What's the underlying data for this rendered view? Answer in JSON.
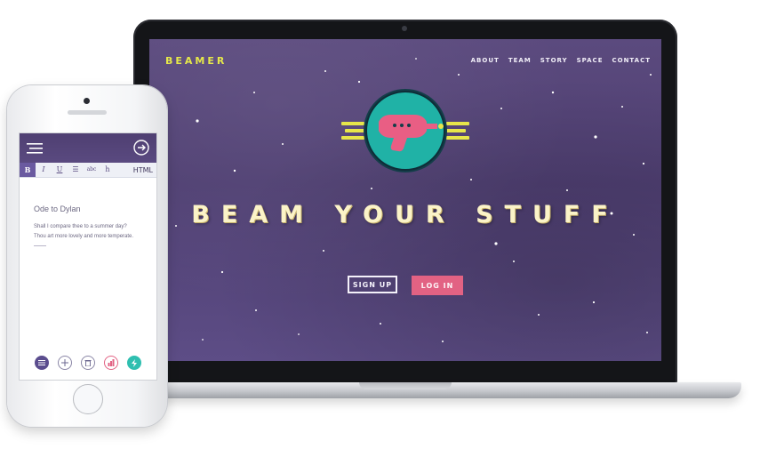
{
  "laptop": {
    "brand": "BEAMER",
    "nav": [
      "ABOUT",
      "TEAM",
      "STORY",
      "SPACE",
      "CONTACT"
    ],
    "hero_title": "BEAM YOUR STUFF",
    "signup_label": "SIGN UP",
    "login_label": "LOG IN",
    "colors": {
      "brand": "#e5e84a",
      "login_button": "#e26283",
      "badge_teal": "#1fb1a6",
      "background": "#54437a"
    },
    "logo_icon": "ray-gun-icon"
  },
  "phone": {
    "toolbar": {
      "bold": "B",
      "italic": "I",
      "underline": "U",
      "list": "☰",
      "strike": "abc",
      "heading": "h",
      "html": "HTML"
    },
    "document": {
      "title": "Ode to Dylan",
      "line1": "Shall I compare thee to a summer day?",
      "line2": "Thou art more lovely and more temperate."
    },
    "icons": [
      "menu-icon",
      "forward-arrow-icon",
      "list-icon",
      "add-icon",
      "trash-icon",
      "chart-icon",
      "bolt-icon"
    ]
  }
}
